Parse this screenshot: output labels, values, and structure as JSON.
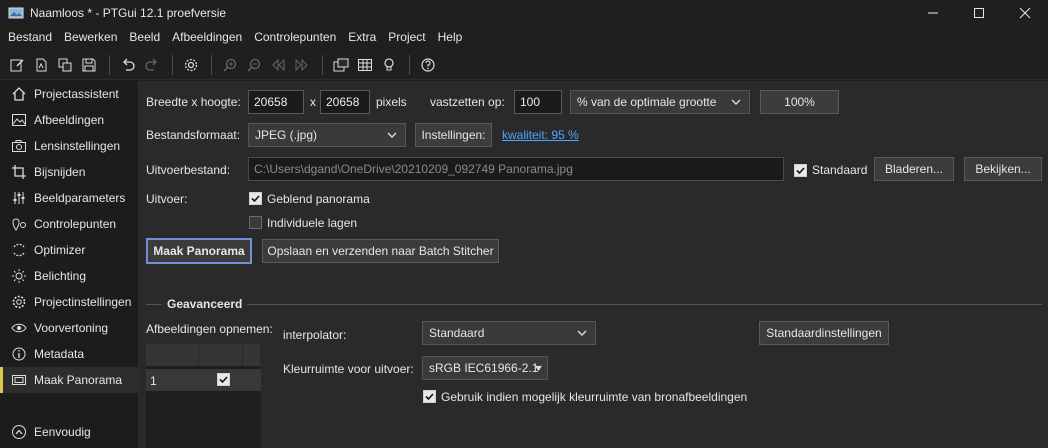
{
  "window": {
    "title": "Naamloos * - PTGui 12.1 proefversie",
    "minimize": "—",
    "maximize": "☐",
    "close": "✕"
  },
  "menu": [
    "Bestand",
    "Bewerken",
    "Beeld",
    "Afbeeldingen",
    "Controlepunten",
    "Extra",
    "Project",
    "Help"
  ],
  "toolbar_icons": [
    "edit-icon",
    "new-project-icon",
    "copy-icon",
    "save-icon",
    "undo-icon",
    "redo-icon",
    "settings-icon",
    "zoom-in-icon",
    "zoom-out-icon",
    "previous-icon",
    "next-icon",
    "panorama-editor-icon",
    "grid-icon",
    "lightbulb-icon",
    "help-icon"
  ],
  "sidebar": {
    "items": [
      {
        "label": "Projectassistent",
        "icon": "home-icon"
      },
      {
        "label": "Afbeeldingen",
        "icon": "image-icon"
      },
      {
        "label": "Lensinstellingen",
        "icon": "camera-icon"
      },
      {
        "label": "Bijsnijden",
        "icon": "crop-icon"
      },
      {
        "label": "Beeldparameters",
        "icon": "sliders-icon"
      },
      {
        "label": "Controlepunten",
        "icon": "control-points-icon"
      },
      {
        "label": "Optimizer",
        "icon": "optimizer-icon"
      },
      {
        "label": "Belichting",
        "icon": "sun-icon"
      },
      {
        "label": "Projectinstellingen",
        "icon": "gear-icon"
      },
      {
        "label": "Voorvertoning",
        "icon": "eye-icon"
      },
      {
        "label": "Metadata",
        "icon": "info-icon"
      },
      {
        "label": "Maak Panorama",
        "icon": "panorama-icon"
      }
    ],
    "active_index": 11,
    "bottom": {
      "label": "Eenvoudig",
      "icon": "chevron-up-circle-icon"
    }
  },
  "output": {
    "size_label": "Breedte x hoogte:",
    "width": "20658",
    "x_label": "x",
    "height": "20658",
    "pixels_label": "pixels",
    "lock_label": "vastzetten op:",
    "lock_value": "100",
    "lock_mode": "% van de optimale grootte",
    "percent_button": "100%",
    "format_label": "Bestandsformaat:",
    "format_value": "JPEG (.jpg)",
    "settings_button": "Instellingen:",
    "quality_link": "kwaliteit: 95 %",
    "file_label": "Uitvoerbestand:",
    "file_value": "C:\\Users\\dgand\\OneDrive\\20210209_092749 Panorama.jpg",
    "default_label": "Standaard",
    "browse_button": "Bladeren...",
    "view_button": "Bekijken...",
    "output_label": "Uitvoer:",
    "blended_label": "Geblend panorama",
    "layers_label": "Individuele lagen",
    "make_button": "Maak Panorama",
    "batch_button": "Opslaan en verzenden naar Batch Stitcher"
  },
  "advanced": {
    "title": "Geavanceerd",
    "include_label": "Afbeeldingen opnemen:",
    "table_row": "1",
    "interpolator_label": "interpolator:",
    "interpolator_value": "Standaard",
    "defaults_button": "Standaardinstellingen",
    "colorspace_label": "Kleurruimte voor uitvoer:",
    "colorspace_value": "sRGB IEC61966-2.1",
    "use_source_label": "Gebruik indien mogelijk kleurruimte van bronafbeeldingen"
  },
  "colors": {
    "accent_active": "#d9c84a",
    "link": "#4ea3ff",
    "primary_border": "#6f8fd6"
  }
}
